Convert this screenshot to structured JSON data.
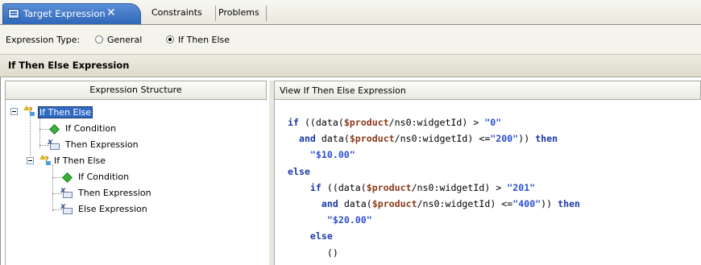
{
  "tabs": {
    "active": {
      "label": "Target Expression",
      "close": "✕"
    },
    "others": [
      {
        "label": "Constraints"
      },
      {
        "label": "Problems"
      }
    ]
  },
  "expression_type": {
    "label": "Expression Type:",
    "options": [
      {
        "label": "General",
        "checked": false
      },
      {
        "label": "If Then Else",
        "checked": true
      }
    ]
  },
  "section": {
    "title": "If Then Else Expression"
  },
  "structure_pane": {
    "header": "Expression Structure",
    "tree": [
      {
        "label": "If Then Else",
        "icon": "if-then-else-icon",
        "selected": true
      },
      {
        "label": "If Condition",
        "icon": "condition-diamond-icon"
      },
      {
        "label": "Then Expression",
        "icon": "expression-icon"
      },
      {
        "label": "If Then Else",
        "icon": "if-then-else-icon"
      },
      {
        "label": "If Condition",
        "icon": "condition-diamond-icon"
      },
      {
        "label": "Then Expression",
        "icon": "expression-icon"
      },
      {
        "label": "Else Expression",
        "icon": "expression-icon"
      }
    ]
  },
  "view_pane": {
    "header": "View If Then Else Expression",
    "lines": [
      [
        {
          "t": "if",
          "c": "kw"
        },
        {
          "t": " ((data("
        },
        {
          "t": "$product",
          "c": "var"
        },
        {
          "t": "/ns0:widgetId) > "
        },
        {
          "t": "\"0\"",
          "c": "str"
        }
      ],
      [
        {
          "t": "  "
        },
        {
          "t": "and",
          "c": "kw"
        },
        {
          "t": " data("
        },
        {
          "t": "$product",
          "c": "var"
        },
        {
          "t": "/ns0:widgetId) <="
        },
        {
          "t": "\"200\"",
          "c": "str"
        },
        {
          "t": ")) "
        },
        {
          "t": "then",
          "c": "kw"
        }
      ],
      [
        {
          "t": "    "
        },
        {
          "t": "\"$10.00\"",
          "c": "str"
        }
      ],
      [
        {
          "t": "else",
          "c": "kw"
        }
      ],
      [
        {
          "t": "    "
        },
        {
          "t": "if",
          "c": "kw"
        },
        {
          "t": " ((data("
        },
        {
          "t": "$product",
          "c": "var"
        },
        {
          "t": "/ns0:widgetId) > "
        },
        {
          "t": "\"201\"",
          "c": "str"
        }
      ],
      [
        {
          "t": "      "
        },
        {
          "t": "and",
          "c": "kw"
        },
        {
          "t": " data("
        },
        {
          "t": "$product",
          "c": "var"
        },
        {
          "t": "/ns0:widgetId) <="
        },
        {
          "t": "\"400\"",
          "c": "str"
        },
        {
          "t": ")) "
        },
        {
          "t": "then",
          "c": "kw"
        }
      ],
      [
        {
          "t": "       "
        },
        {
          "t": "\"$20.00\"",
          "c": "str"
        }
      ],
      [
        {
          "t": "    "
        },
        {
          "t": "else",
          "c": "kw"
        }
      ],
      [
        {
          "t": "       ()"
        }
      ]
    ]
  },
  "colors": {
    "keyword": "#1a3aa8",
    "string": "#2a4fd0",
    "variable": "#8a3a1a",
    "active_tab": "#3a72c4",
    "selection": "#316ac5"
  }
}
